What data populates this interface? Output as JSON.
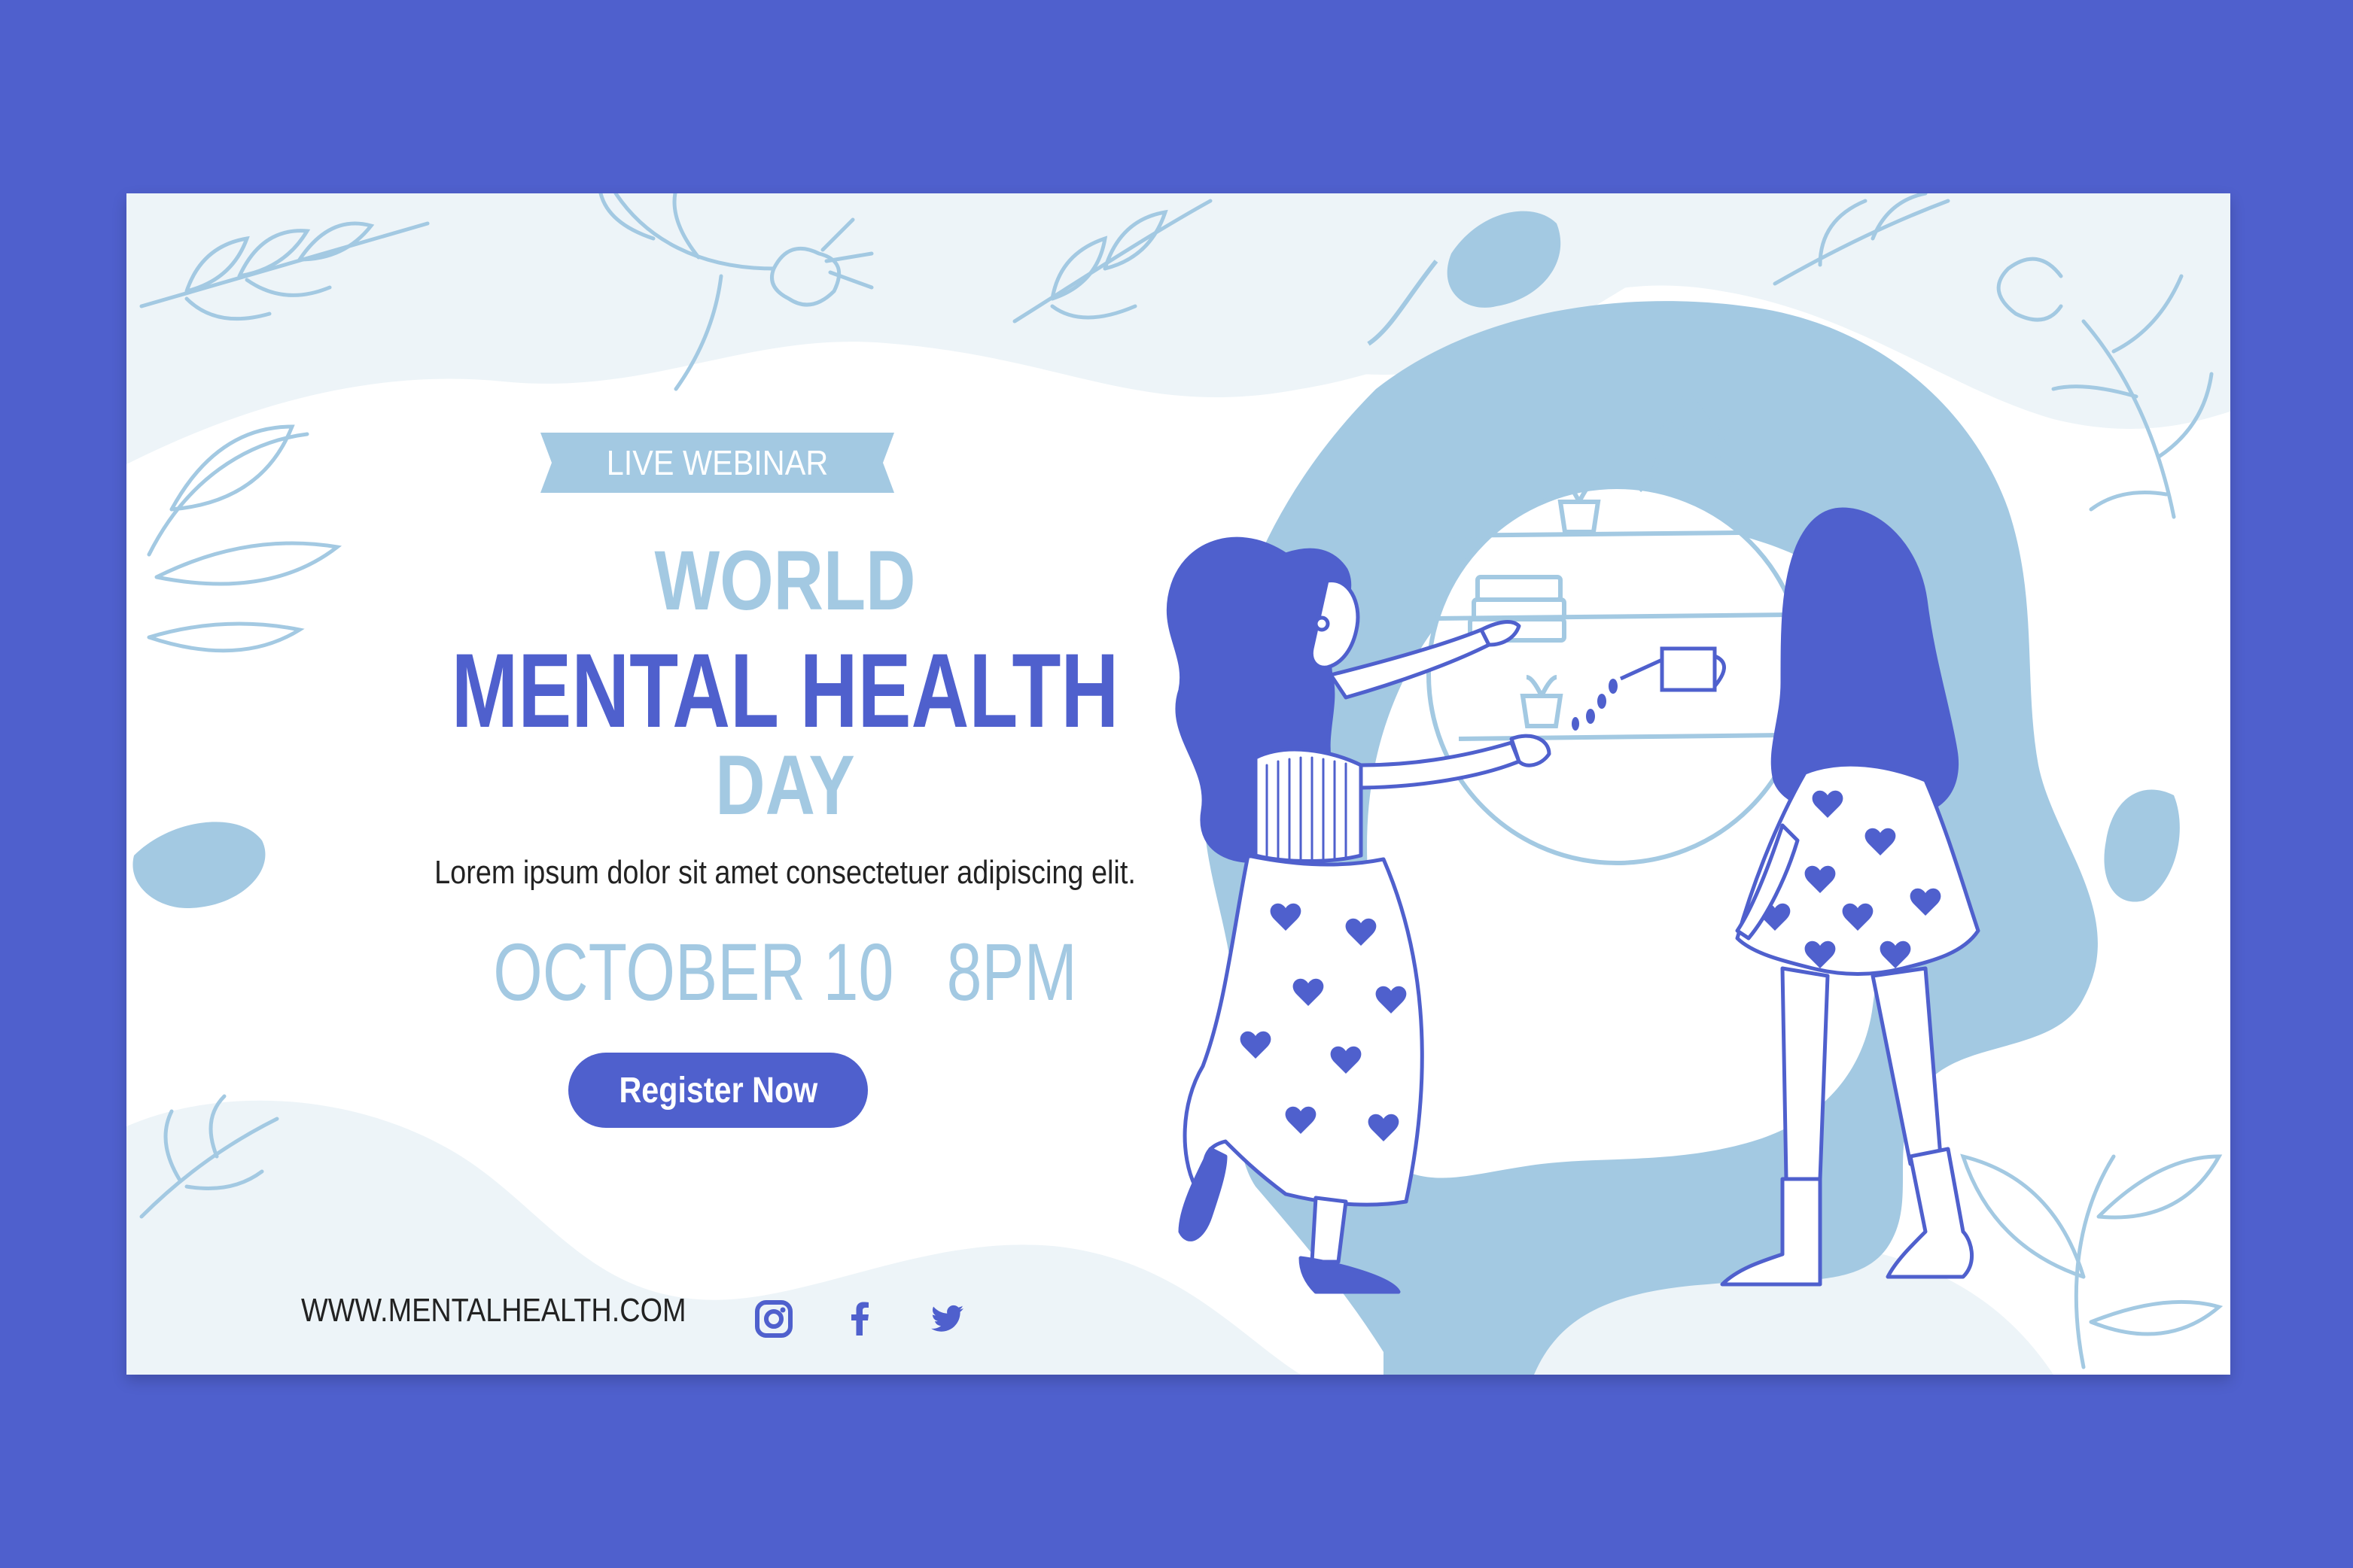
{
  "badge": {
    "label": "LIVE WEBINAR"
  },
  "title": {
    "line1": "WORLD",
    "line2": "MENTAL HEALTH",
    "line3": "DAY"
  },
  "subtitle": "Lorem ipsum dolor sit amet consectetuer adipiscing elit.",
  "event": {
    "date": "OCTOBER 10",
    "time": "8PM"
  },
  "cta": {
    "label": "Register Now"
  },
  "footer": {
    "website": "WWW.MENTALHEALTH.COM"
  },
  "social": {
    "icons": [
      "instagram-icon",
      "facebook-icon",
      "twitter-icon"
    ]
  },
  "colors": {
    "frame": "#4f60cd",
    "primary": "#4f60cd",
    "light_blue": "#a3c9e2",
    "pale_blue": "#edf4f8",
    "text_dark": "#222222"
  }
}
